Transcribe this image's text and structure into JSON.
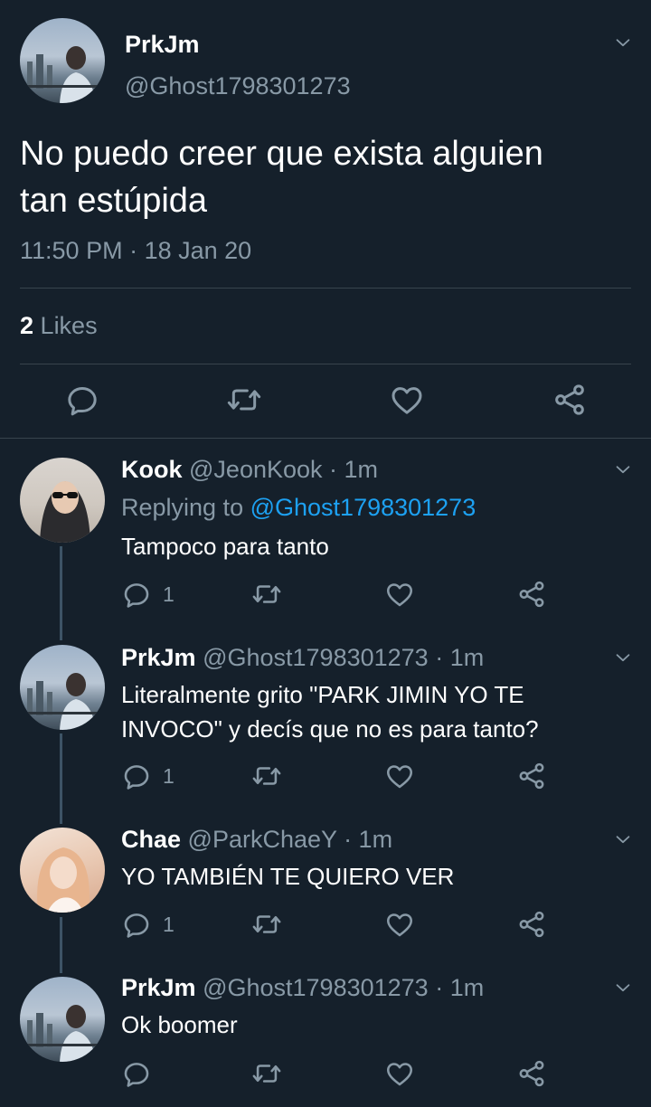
{
  "tweet": {
    "display_name": "PrkJm",
    "handle": "@Ghost1798301273",
    "text_line1": "No puedo creer que exista alguien",
    "text_line2": "tan estúpida",
    "time": "11:50 PM",
    "date": "18 Jan 20",
    "likes_count": "2",
    "likes_label": "Likes"
  },
  "replies": [
    {
      "name": "Kook",
      "handle": "@JeonKook",
      "time": "· 1m",
      "replying_prefix": "Replying to",
      "replying_handle": "@Ghost1798301273",
      "text_line1": "Tampoco para tanto",
      "text_line2": "",
      "reply_count": "1"
    },
    {
      "name": "PrkJm",
      "handle": "@Ghost1798301273",
      "time": "· 1m",
      "text_line1": "Literalmente grito \"PARK JIMIN YO TE",
      "text_line2": "INVOCO\" y decís que no es para tanto?",
      "reply_count": "1"
    },
    {
      "name": "Chae",
      "handle": "@ParkChaeY",
      "time": "· 1m",
      "text_line1": "YO TAMBIÉN TE QUIERO VER",
      "text_line2": "",
      "reply_count": "1"
    },
    {
      "name": "PrkJm",
      "handle": "@Ghost1798301273",
      "time": "· 1m",
      "text_line1": "Ok boomer",
      "text_line2": "",
      "reply_count": ""
    }
  ],
  "icons": {
    "chevron": "chevron-down-icon",
    "reply": "reply-icon",
    "retweet": "retweet-icon",
    "like": "heart-icon",
    "share": "share-icon"
  },
  "colors": {
    "background": "#15202b",
    "muted": "#8899a6",
    "link": "#1da1f2",
    "divider": "#38444d"
  }
}
